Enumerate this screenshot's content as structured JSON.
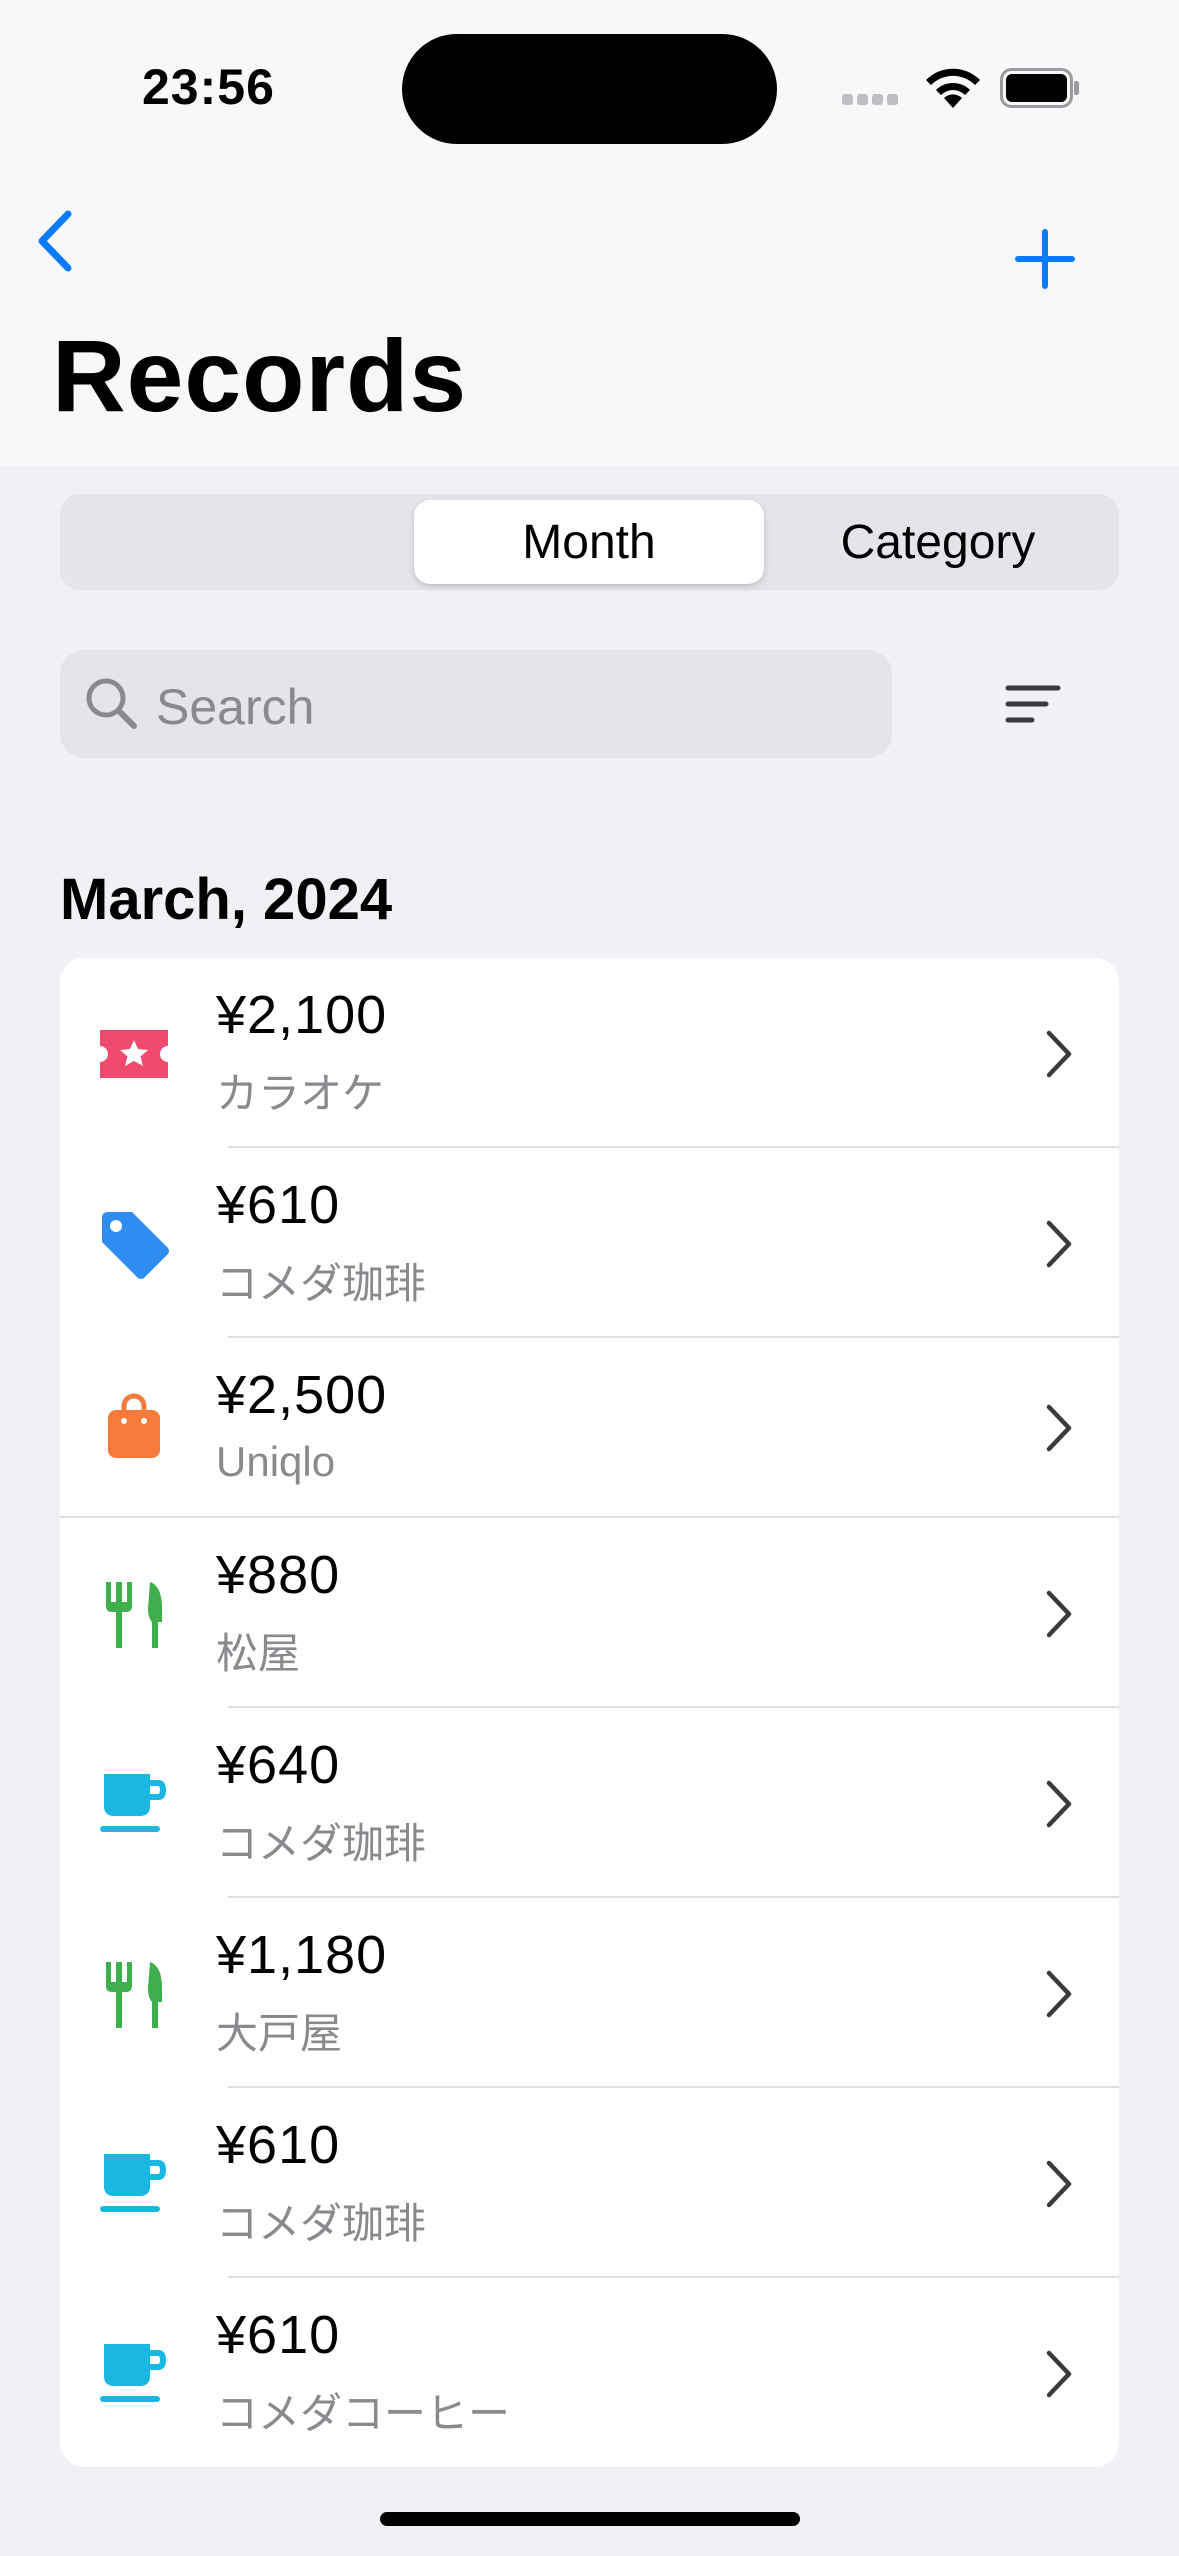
{
  "status_bar": {
    "time": "23:56"
  },
  "nav": {
    "title": "Records"
  },
  "segments": {
    "blank": "",
    "month": "Month",
    "category": "Category"
  },
  "search": {
    "placeholder": "Search"
  },
  "section": {
    "title": "March, 2024"
  },
  "colors": {
    "accent": "#0a7aff",
    "ticket": "#f04a6e",
    "tag": "#2f8cf0",
    "bag": "#f47b3c",
    "food": "#3fae4c",
    "cafe": "#1ab8e0"
  },
  "records": [
    {
      "amount": "¥2,100",
      "memo": "カラオケ",
      "icon": "ticket-icon"
    },
    {
      "amount": "¥610",
      "memo": "コメダ珈琲",
      "icon": "tag-icon"
    },
    {
      "amount": "¥2,500",
      "memo": "Uniqlo",
      "icon": "shopping-bag-icon"
    },
    {
      "amount": "¥880",
      "memo": "松屋",
      "icon": "fork-knife-icon"
    },
    {
      "amount": "¥640",
      "memo": "コメダ珈琲",
      "icon": "coffee-cup-icon"
    },
    {
      "amount": "¥1,180",
      "memo": "大戸屋",
      "icon": "fork-knife-icon"
    },
    {
      "amount": "¥610",
      "memo": "コメダ珈琲",
      "icon": "coffee-cup-icon"
    },
    {
      "amount": "¥610",
      "memo": "コメダコーヒー",
      "icon": "coffee-cup-icon"
    }
  ]
}
